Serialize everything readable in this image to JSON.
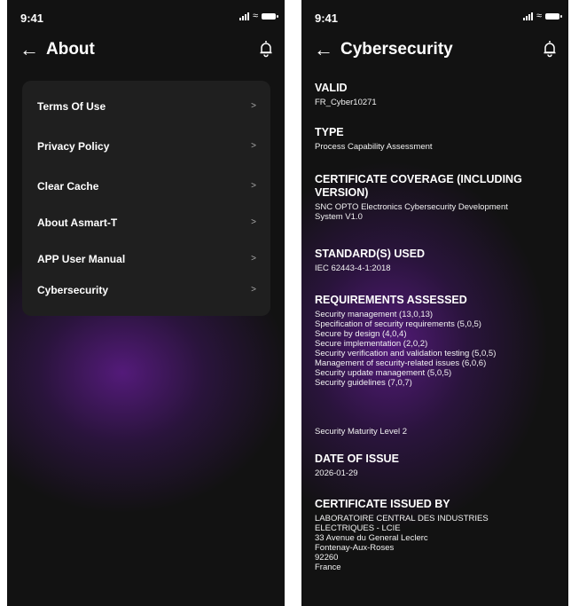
{
  "left_screen": {
    "status": {
      "time": "9:41"
    },
    "header": {
      "title": "About"
    },
    "menu": [
      {
        "label": "Terms Of Use",
        "chevron": ">"
      },
      {
        "label": "Privacy Policy",
        "chevron": ">"
      },
      {
        "label": "Clear Cache",
        "chevron": ">"
      },
      {
        "label": "About Asmart-T",
        "chevron": ">"
      },
      {
        "label": "APP User Manual",
        "chevron": ">"
      },
      {
        "label": "Cybersecurity",
        "chevron": ">"
      }
    ]
  },
  "right_screen": {
    "status": {
      "time": "9:41"
    },
    "header": {
      "title": "Cybersecurity"
    },
    "valid": {
      "title": "VALID",
      "value": "FR_Cyber10271"
    },
    "type": {
      "title": "TYPE",
      "value": "Process Capability Assessment"
    },
    "coverage": {
      "title_line1": "CERTIFICATE COVERAGE (INCLUDING",
      "title_line2": "VERSION)",
      "value_line1": "SNC OPTO Electronics Cybersecurity Development",
      "value_line2": "System V1.0"
    },
    "standards": {
      "title": "STANDARD(S) USED",
      "value": "IEC 62443-4-1:2018"
    },
    "requirements": {
      "title": "REQUIREMENTS ASSESSED",
      "items": [
        "Security management (13,0,13)",
        "Specification of security requirements (5,0,5)",
        "Secure by design (4,0,4)",
        "Secure implementation (2,0,2)",
        "Security verification and validation testing (5,0,5)",
        "Management of security-related issues (6,0,6)",
        "Security update management (5,0,5)",
        "Security guidelines (7,0,7)"
      ],
      "maturity": "Security Maturity Level 2"
    },
    "date": {
      "title": "DATE OF ISSUE",
      "value": "2026-01-29"
    },
    "issuer": {
      "title": "CERTIFICATE ISSUED BY",
      "lines": [
        "LABORATOIRE CENTRAL DES INDUSTRIES",
        "ELECTRIQUES - LCIE",
        "33 Avenue du General Leclerc",
        "Fontenay-Aux-Roses",
        "92260",
        "France"
      ]
    }
  },
  "icons": {
    "back": "arrow-left-icon",
    "notification": "bell-icon",
    "chevron": "chevron-right-icon",
    "signal": "signal-icon",
    "wifi": "wifi-icon",
    "battery": "battery-icon"
  },
  "colors": {
    "background": "#121212",
    "card": "#1f1f1f",
    "accent_glow": "#5f1c8c",
    "text": "#ffffff",
    "chevron": "#aaaaaa"
  }
}
